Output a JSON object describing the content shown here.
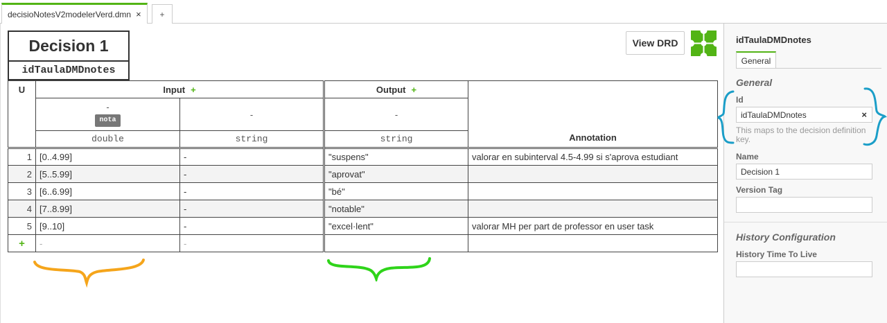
{
  "tabs": {
    "active_label": "decisioNotesV2modelerVerd.dmn",
    "close_glyph": "×",
    "add_label": "+"
  },
  "header": {
    "view_drd_label": "View DRD",
    "logo_icon": "dmn-logo-icon"
  },
  "decision": {
    "name": "Decision 1",
    "id": "idTaulaDMDnotes"
  },
  "table": {
    "hit_policy": "U",
    "input_header": "Input",
    "output_header": "Output",
    "annotation_header": "Annotation",
    "add_glyph": "+",
    "columns": [
      {
        "label": "-",
        "var_badge": "nota",
        "type": "double"
      },
      {
        "label": "-",
        "type": "string"
      },
      {
        "label": "-",
        "type": "string"
      }
    ],
    "rows": [
      {
        "num": "1",
        "in1": "[0..4.99]",
        "in2": "-",
        "out": "\"suspens\"",
        "ann": "valorar en subinterval 4.5-4.99 si s'aprova estudiant"
      },
      {
        "num": "2",
        "in1": "[5..5.99]",
        "in2": "-",
        "out": "\"aprovat\"",
        "ann": ""
      },
      {
        "num": "3",
        "in1": "[6..6.99]",
        "in2": "-",
        "out": "\"bé\"",
        "ann": ""
      },
      {
        "num": "4",
        "in1": "[7..8.99]",
        "in2": "-",
        "out": "\"notable\"",
        "ann": ""
      },
      {
        "num": "5",
        "in1": "[9..10]",
        "in2": "-",
        "out": "\"excel·lent\"",
        "ann": "valorar MH per part de professor en user task"
      }
    ],
    "add_row": {
      "num": "+",
      "in1": "-",
      "in2": "-",
      "out": "",
      "ann": ""
    }
  },
  "panel": {
    "title": "idTaulaDMDnotes",
    "tab_label": "General",
    "group_general": "General",
    "id_label": "Id",
    "id_value": "idTaulaDMDnotes",
    "id_clear": "×",
    "id_hint": "This maps to the decision definition key.",
    "name_label": "Name",
    "name_value": "Decision 1",
    "version_label": "Version Tag",
    "version_value": "",
    "group_history": "History Configuration",
    "ttl_label": "History Time To Live",
    "ttl_value": ""
  },
  "colors": {
    "accent": "#52b415",
    "scribble_orange": "#f5a51b",
    "scribble_green": "#2fd41a",
    "scribble_blue": "#1b9ec8"
  }
}
